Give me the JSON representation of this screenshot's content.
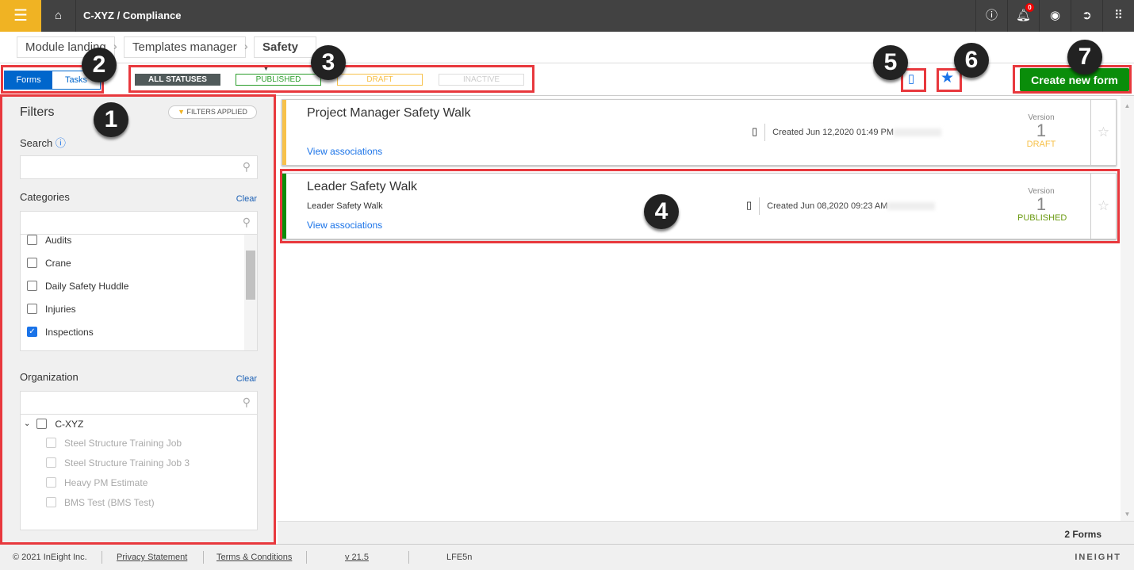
{
  "topbar": {
    "menu_icon": "hamburger-icon",
    "home_icon": "home-icon",
    "title": "C-XYZ  /  Compliance",
    "notification_count": "0",
    "icons": [
      "help-icon",
      "bell-icon",
      "user-icon",
      "signout-icon",
      "apps-grid-icon"
    ]
  },
  "breadcrumb": {
    "items": [
      "Module landing",
      "Templates manager",
      "Safety"
    ]
  },
  "toolbar": {
    "forms": "Forms",
    "tasks": "Tasks",
    "statuses": [
      "ALL STATUSES",
      "PUBLISHED",
      "DRAFT",
      "INACTIVE"
    ],
    "create": "Create new form"
  },
  "callouts": [
    "1",
    "2",
    "3",
    "4",
    "5",
    "6",
    "7"
  ],
  "filters": {
    "title": "Filters",
    "applied": "FILTERS APPLIED",
    "search_label": "Search",
    "search_value": "",
    "categories_label": "Categories",
    "clear": "Clear",
    "categories": [
      {
        "label": "Audits",
        "checked": false
      },
      {
        "label": "Crane",
        "checked": false
      },
      {
        "label": "Daily Safety Huddle",
        "checked": false
      },
      {
        "label": "Injuries",
        "checked": false
      },
      {
        "label": "Inspections",
        "checked": true
      }
    ],
    "organization_label": "Organization",
    "org_root": "C-XYZ",
    "org_children": [
      "Steel Structure Training Job",
      "Steel Structure Training Job 3",
      "Heavy PM Estimate",
      "BMS Test (BMS Test)"
    ]
  },
  "forms": [
    {
      "title": "Project Manager Safety Walk",
      "subtitle": "",
      "created": "Created Jun 12,2020 01:49 PM",
      "view": "View associations",
      "version_label": "Version",
      "version": "1",
      "status": "DRAFT",
      "color": "#f7c14a"
    },
    {
      "title": "Leader Safety Walk",
      "subtitle": "Leader Safety Walk",
      "created": "Created Jun 08,2020 09:23 AM",
      "view": "View associations",
      "version_label": "Version",
      "version": "1",
      "status": "PUBLISHED",
      "color": "#0a8d0a"
    }
  ],
  "count": "2 Forms",
  "footer": {
    "copyright": "© 2021 InEight Inc.",
    "privacy": "Privacy Statement",
    "terms": "Terms & Conditions",
    "version": "v 21.5",
    "code": "LFE5n",
    "logo": "INEIGHT"
  },
  "colors": {
    "accent": "#f0b323",
    "primary": "#0066cc",
    "create": "#0a8d0a",
    "published": "#2a9d2a",
    "draft": "#f7c14a"
  }
}
